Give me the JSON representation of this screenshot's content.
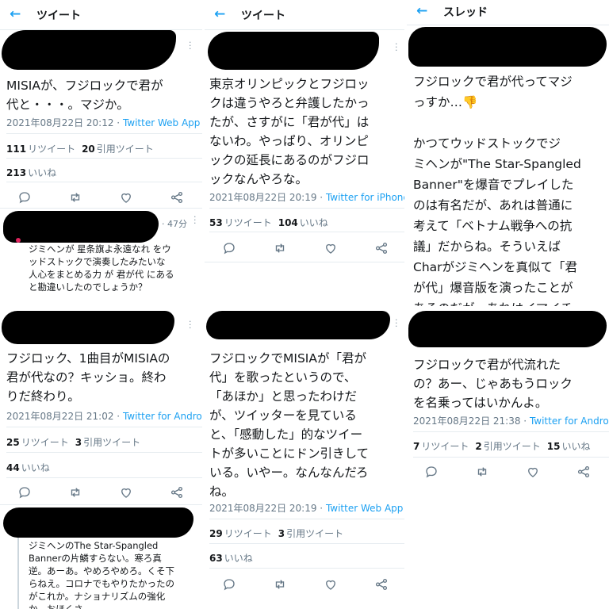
{
  "panels": [
    {
      "header_title": "ツイート",
      "text": "MISIAが、フジロックで君が\n代と・・・。マジか。",
      "date": "2021年08月22日 20:12",
      "client": "Twitter Web App",
      "stats": [
        {
          "n": "111",
          "label": "リツイート"
        },
        {
          "n": "20",
          "label": "引用ツイート"
        }
      ],
      "stats2": [
        {
          "n": "213",
          "label": "いいね"
        }
      ],
      "reply": {
        "time": "47分",
        "text": "ジミヘンが 星条旗よ永遠なれ をウ\nッドストックで演奏したみたいな\n人心をまとめる力 が 君が代 にある\nと勘違いしたのでしょうか？"
      }
    },
    {
      "header_title": "ツイート",
      "text": "東京オリンピックとフジロッ\nクは違うやろと弁護したかっ\nたが、さすがに「君が代」は\nないわ。やっぱり、オリンピ\nックの延長にあるのがフジロ\nックなんやろな。",
      "date": "2021年08月22日 20:19",
      "client": "Twitter for iPhone",
      "stats": [
        {
          "n": "53",
          "label": "リツイート"
        },
        {
          "n": "104",
          "label": "いいね"
        }
      ]
    },
    {
      "header_title": "スレッド",
      "text": "フジロックで君が代ってマジ\nっすか…👎\n\nかつてウッドストックでジ\nミヘンが\"The Star-Spangled\nBanner\"を爆音でプレイした\nのは有名だが、あれは普通に\n考えて「ベトナム戦争への抗\n議」だからね。そういえば\nCharがジミヘンを真似て「君\nが代」爆音版を演ったことが\nあるのだが、あれはイマイチ\nだったかな😶"
    },
    {
      "text": "フジロック、1曲目がMISIAの\n君が代なの？キッショ。終わ\nりだ終わり。",
      "date": "2021年08月22日 21:02",
      "client": "Twitter for Android",
      "stats": [
        {
          "n": "25",
          "label": "リツイート"
        },
        {
          "n": "3",
          "label": "引用ツイート"
        }
      ],
      "stats2": [
        {
          "n": "44",
          "label": "いいね"
        }
      ],
      "reply": {
        "text": "ジミヘンのThe Star-Spangled\nBannerの片鱗すらない。寒ろ真\n逆。あーあ。やめろやめろ。くそ下\nらねえ。コロナでもやりたかったの\nがこれか。ナショナリズムの強化\nか。おほくさ"
      }
    },
    {
      "text": "フジロックでMISIAが「君が\n代」を歌ったというので、\n「あほか」と思ったわけだ\nが、ツイッターを見ている\nと、「感動した」的なツイー\nトが多いことにドン引きして\nいる。いやー。なんなんだろ\nね。",
      "date": "2021年08月22日 20:19",
      "client": "Twitter Web App",
      "stats": [
        {
          "n": "29",
          "label": "リツイート"
        },
        {
          "n": "3",
          "label": "引用ツイート"
        }
      ],
      "stats2": [
        {
          "n": "63",
          "label": "いいね"
        }
      ]
    },
    {
      "text": "フジロックで君が代流れた\nの？あー、じゃあもうロック\nを名乗ってはいかんよ。",
      "date": "2021年08月22日 21:38",
      "client": "Twitter for Android",
      "stats": [
        {
          "n": "7",
          "label": "リツイート"
        },
        {
          "n": "2",
          "label": "引用ツイート"
        },
        {
          "n": "15",
          "label": "いいね"
        }
      ]
    }
  ],
  "icons": [
    "back-arrow-icon",
    "more-icon",
    "reply-icon",
    "retweet-icon",
    "like-icon",
    "share-icon"
  ],
  "colors": {
    "accent": "#1da1f2",
    "text": "#14171a",
    "muted": "#657786",
    "border": "#e6ecf0",
    "redaction": "#000000"
  }
}
